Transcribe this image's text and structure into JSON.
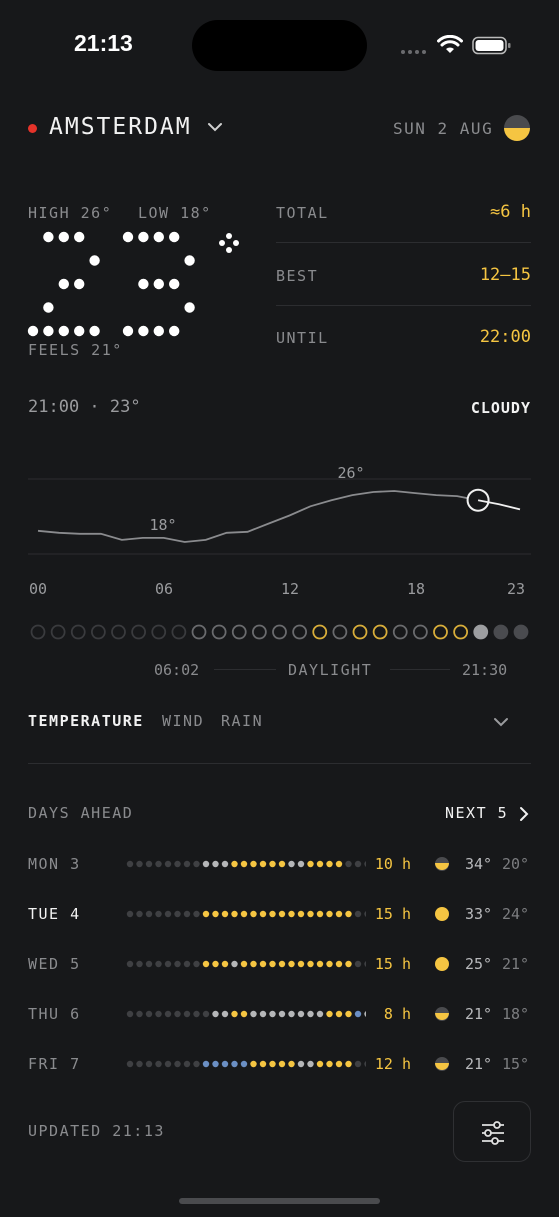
{
  "status_bar": {
    "time": "21:13"
  },
  "header": {
    "city": "AMSTERDAM",
    "date": "SUN 2 AUG"
  },
  "current": {
    "high_label": "HIGH 26°",
    "low_label": "LOW 18°",
    "temperature": "23",
    "feels": "FEELS 21°",
    "time_temp": "21:00 · 23°",
    "condition": "CLOUDY"
  },
  "sun_stats": [
    {
      "label": "TOTAL",
      "value": "≈6 h"
    },
    {
      "label": "BEST",
      "value": "12–15"
    },
    {
      "label": "UNTIL",
      "value": "22:00"
    }
  ],
  "chart": {
    "max_label": "26°",
    "min_label": "18°",
    "x_ticks": [
      "00",
      "06",
      "12",
      "18",
      "23"
    ],
    "temps": [
      19.8,
      19.6,
      19.5,
      19.5,
      18.9,
      19.1,
      19.1,
      18.7,
      18.9,
      19.6,
      19.7,
      20.5,
      21.3,
      22.2,
      22.8,
      23.3,
      23.6,
      23.7,
      23.5,
      23.3,
      23.2,
      22.8,
      22.4,
      21.9
    ],
    "current_hour": 21
  },
  "hourly_sun": [
    "empty",
    "empty",
    "empty",
    "empty",
    "empty",
    "empty",
    "empty",
    "empty",
    "outline",
    "outline",
    "outline",
    "outline",
    "outline",
    "outline",
    "sun",
    "outline",
    "sun",
    "sun",
    "outline",
    "outline",
    "sun",
    "sun",
    "cloud",
    "night",
    "night"
  ],
  "daylight": {
    "sunrise": "06:02",
    "label": "DAYLIGHT",
    "sunset": "21:30"
  },
  "tabs": [
    {
      "label": "TEMPERATURE",
      "active": true
    },
    {
      "label": "WIND",
      "active": false
    },
    {
      "label": "RAIN",
      "active": false
    }
  ],
  "days_ahead": {
    "title": "DAYS AHEAD",
    "next_label": "NEXT 5",
    "days": [
      {
        "name": "MON 3",
        "hours": "10 h",
        "high": "34°",
        "low": "20°",
        "sun_icon": "partly",
        "highlight": false,
        "dots": "ddddddddgggyyyyyyggyyyyddd"
      },
      {
        "name": "TUE 4",
        "hours": "15 h",
        "high": "33°",
        "low": "24°",
        "sun_icon": "full",
        "highlight": true,
        "dots": "ddddddddyyyyyyyyyyyyyyyydd"
      },
      {
        "name": "WED 5",
        "hours": "15 h",
        "high": "25°",
        "low": "21°",
        "sun_icon": "full",
        "highlight": false,
        "dots": "ddddddddyyygyyyyyyyyyyyydd"
      },
      {
        "name": "THU 6",
        "hours": "8 h",
        "high": "21°",
        "low": "18°",
        "sun_icon": "partly",
        "highlight": false,
        "dots": "dddddddddggyyggggggggyyybgd"
      },
      {
        "name": "FRI 7",
        "hours": "12 h",
        "high": "21°",
        "low": "15°",
        "sun_icon": "partly",
        "highlight": false,
        "dots": "ddddddddbbbbbyyyyyggyyyydd"
      }
    ]
  },
  "footer": {
    "updated": "UPDATED 21:13"
  },
  "colors": {
    "background": "#17181a",
    "accent": "#f5c542",
    "live": "#e5332a"
  }
}
